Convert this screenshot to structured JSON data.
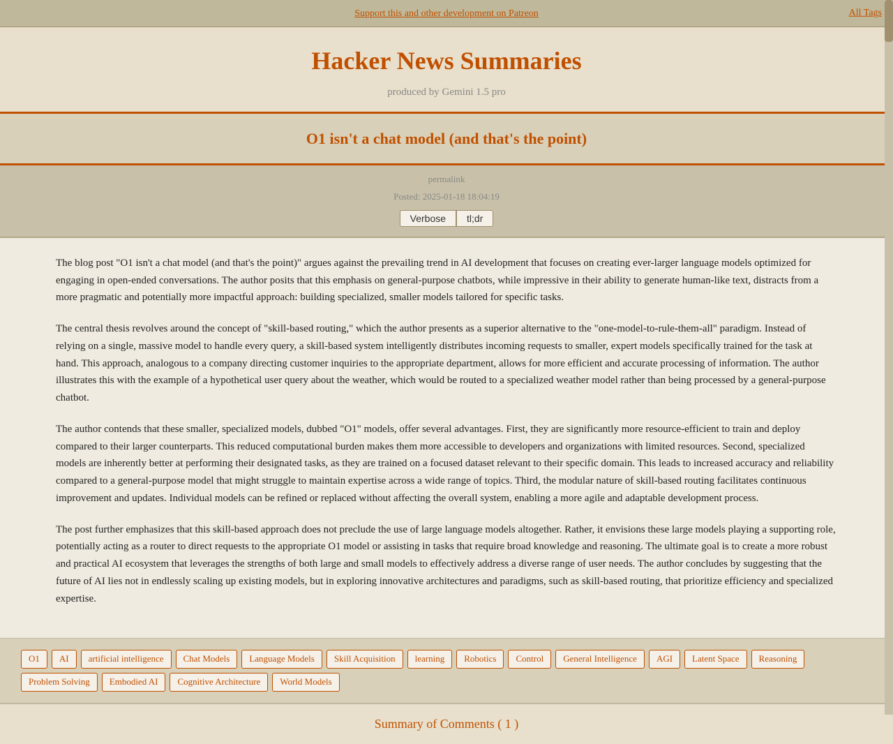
{
  "topbar": {
    "support_link": "Support this and other development on Patreon",
    "all_tags": "All Tags"
  },
  "header": {
    "title": "Hacker News Summaries",
    "subtitle": "produced by Gemini 1.5 pro"
  },
  "article": {
    "title": "O1 isn't a chat model (and that's the point)",
    "permalink": "permalink",
    "posted": "Posted: 2025-01-18 18:04:19",
    "mode_verbose": "Verbose",
    "mode_tldr": "tl;dr",
    "paragraphs": [
      "The blog post \"O1 isn't a chat model (and that's the point)\" argues against the prevailing trend in AI development that focuses on creating ever-larger language models optimized for engaging in open-ended conversations. The author posits that this emphasis on general-purpose chatbots, while impressive in their ability to generate human-like text, distracts from a more pragmatic and potentially more impactful approach: building specialized, smaller models tailored for specific tasks.",
      "The central thesis revolves around the concept of \"skill-based routing,\" which the author presents as a superior alternative to the \"one-model-to-rule-them-all\" paradigm. Instead of relying on a single, massive model to handle every query, a skill-based system intelligently distributes incoming requests to smaller, expert models specifically trained for the task at hand. This approach, analogous to a company directing customer inquiries to the appropriate department, allows for more efficient and accurate processing of information. The author illustrates this with the example of a hypothetical user query about the weather, which would be routed to a specialized weather model rather than being processed by a general-purpose chatbot.",
      "The author contends that these smaller, specialized models, dubbed \"O1\" models, offer several advantages. First, they are significantly more resource-efficient to train and deploy compared to their larger counterparts. This reduced computational burden makes them more accessible to developers and organizations with limited resources. Second, specialized models are inherently better at performing their designated tasks, as they are trained on a focused dataset relevant to their specific domain. This leads to increased accuracy and reliability compared to a general-purpose model that might struggle to maintain expertise across a wide range of topics. Third, the modular nature of skill-based routing facilitates continuous improvement and updates. Individual models can be refined or replaced without affecting the overall system, enabling a more agile and adaptable development process.",
      "The post further emphasizes that this skill-based approach does not preclude the use of large language models altogether. Rather, it envisions these large models playing a supporting role, potentially acting as a router to direct requests to the appropriate O1 model or assisting in tasks that require broad knowledge and reasoning. The ultimate goal is to create a more robust and practical AI ecosystem that leverages the strengths of both large and small models to effectively address a diverse range of user needs. The author concludes by suggesting that the future of AI lies not in endlessly scaling up existing models, but in exploring innovative architectures and paradigms, such as skill-based routing, that prioritize efficiency and specialized expertise."
    ]
  },
  "tags": {
    "items": [
      "O1",
      "AI",
      "artificial intelligence",
      "Chat Models",
      "Language Models",
      "Skill Acquisition",
      "learning",
      "Robotics",
      "Control",
      "General Intelligence",
      "AGI",
      "Latent Space",
      "Reasoning",
      "Problem Solving",
      "Embodied AI",
      "Cognitive Architecture",
      "World Models"
    ]
  },
  "comments_summary": {
    "title": "Summary of Comments ( 1 )"
  }
}
